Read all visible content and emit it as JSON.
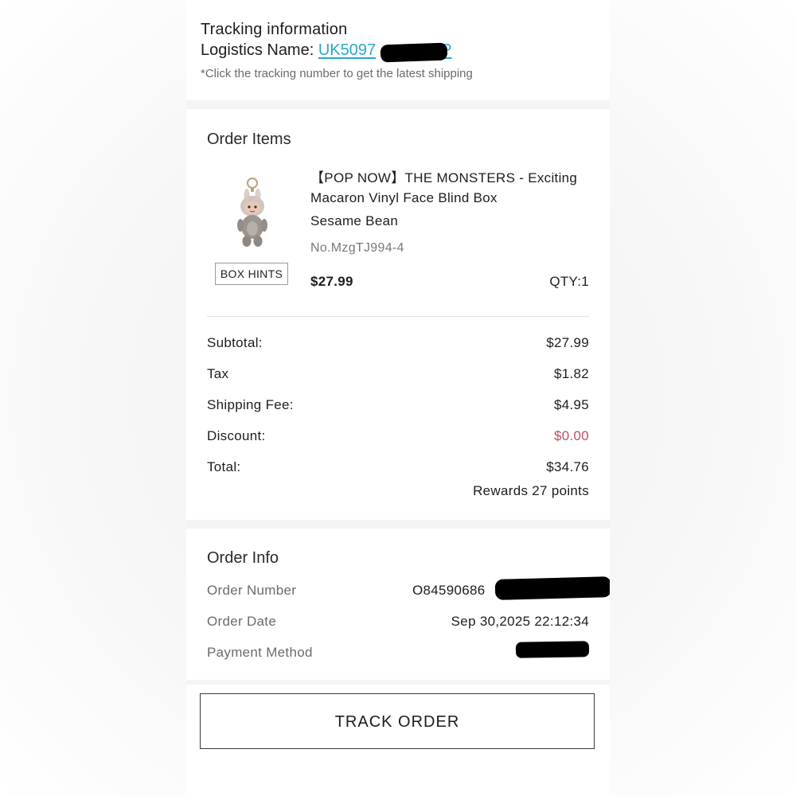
{
  "tracking": {
    "title": "Tracking information",
    "logistics_label": "Logistics Name: ",
    "tracking_number_visible_start": "UK5097",
    "tracking_number_visible_end": "P",
    "hint": "*Click the tracking number to get the latest shipping",
    "link_color": "#2aa7c9"
  },
  "order_items": {
    "title": "Order Items",
    "box_hints_label": "BOX HINTS",
    "product": {
      "name": "【POP NOW】THE MONSTERS - Exciting Macaron Vinyl Face Blind Box",
      "variant": "Sesame Bean",
      "sku": "No.MzgTJ994-4",
      "price": "$27.99",
      "qty": "QTY:1",
      "image_icon": "plush-keychain-figure-icon"
    },
    "summary": {
      "subtotal_label": "Subtotal:",
      "subtotal_value": "$27.99",
      "tax_label": "Tax",
      "tax_value": "$1.82",
      "shipping_label": "Shipping Fee:",
      "shipping_value": "$4.95",
      "discount_label": "Discount:",
      "discount_value": "$0.00",
      "total_label": "Total:",
      "total_value": "$34.76",
      "rewards": "Rewards 27 points",
      "discount_color": "#c0505f"
    }
  },
  "order_info": {
    "title": "Order Info",
    "order_number_label": "Order Number",
    "order_number_visible": "O84590686",
    "order_date_label": "Order Date",
    "order_date_value": "Sep 30,2025 22:12:34",
    "payment_method_label": "Payment Method"
  },
  "actions": {
    "track_order_label": "TRACK ORDER"
  }
}
